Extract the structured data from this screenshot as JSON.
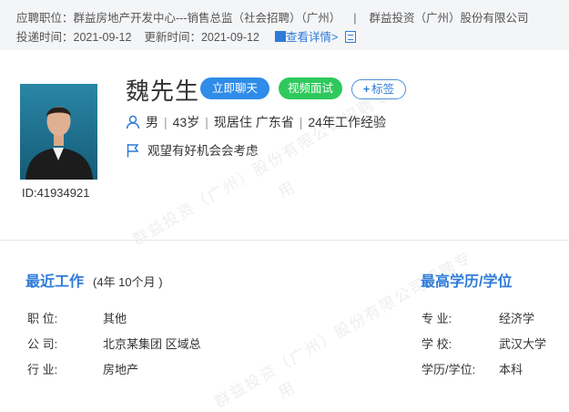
{
  "header": {
    "position_label": "应聘职位：",
    "position_value": "群益房地产开发中心---销售总监（社会招聘）（广州）",
    "separator": "|",
    "company": "群益投资（广州）股份有限公司",
    "delivered_label": "投递时间：",
    "delivered_value": "2021-09-12",
    "updated_label": "更新时间：",
    "updated_value": "2021-09-12",
    "detail_link": "查看详情>"
  },
  "profile": {
    "name": "魏先生",
    "id_text": "ID:41934921",
    "gender": "男",
    "age": "43岁",
    "residence": "现居住 广东省",
    "experience": "24年工作经验",
    "job_status": "观望有好机会会考虑"
  },
  "actions": {
    "chat": "立即聊天",
    "video": "视频面试",
    "tag": "标签"
  },
  "recent_work": {
    "title": "最近工作",
    "duration": "(4年 10个月 )",
    "rows": [
      {
        "label": "职    位:",
        "value": "其他"
      },
      {
        "label": "公    司:",
        "value": "北京某集团 区域总"
      },
      {
        "label": "行    业:",
        "value": "房地产"
      }
    ]
  },
  "education": {
    "title": "最高学历/学位",
    "rows": [
      {
        "label": "专    业:",
        "value": "经济学"
      },
      {
        "label": "学    校:",
        "value": "武汉大学"
      },
      {
        "label": "学历/学位:",
        "value": "本科"
      }
    ]
  },
  "watermark": {
    "line1": "群益投资（广州）股份有限公司招聘专",
    "line2": "用"
  },
  "colors": {
    "accent": "#2f7bd9",
    "chat_button": "#2f8ce8",
    "video_button": "#2ec95c"
  }
}
